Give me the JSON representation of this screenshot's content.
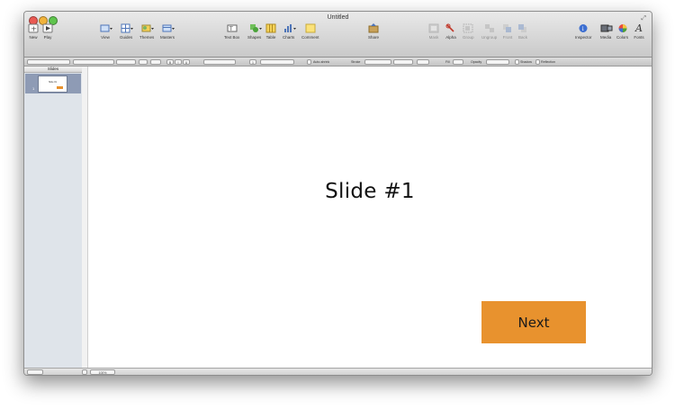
{
  "window": {
    "title": "Untitled",
    "traffic_colors": {
      "close": "#ea5a53",
      "minimize": "#f1b33b",
      "zoom": "#5fc44d"
    }
  },
  "toolbar": {
    "new": {
      "label": "New",
      "icon": "new-slide-icon"
    },
    "play": {
      "label": "Play",
      "icon": "play-icon"
    },
    "view": {
      "label": "View",
      "icon": "view-icon"
    },
    "guides": {
      "label": "Guides",
      "icon": "guides-icon"
    },
    "themes": {
      "label": "Themes",
      "icon": "themes-icon"
    },
    "masters": {
      "label": "Masters",
      "icon": "masters-icon"
    },
    "text_box": {
      "label": "Text Box",
      "icon": "text-box-icon"
    },
    "shapes": {
      "label": "Shapes",
      "icon": "shapes-icon"
    },
    "table": {
      "label": "Table",
      "icon": "table-icon"
    },
    "charts": {
      "label": "Charts",
      "icon": "charts-icon"
    },
    "comment": {
      "label": "Comment",
      "icon": "comment-icon"
    },
    "share": {
      "label": "Share",
      "icon": "share-icon"
    },
    "mask": {
      "label": "Mask",
      "icon": "mask-icon"
    },
    "alpha": {
      "label": "Alpha",
      "icon": "alpha-icon"
    },
    "group": {
      "label": "Group",
      "icon": "group-icon"
    },
    "ungroup": {
      "label": "Ungroup",
      "icon": "ungroup-icon"
    },
    "front": {
      "label": "Front",
      "icon": "front-icon"
    },
    "back": {
      "label": "Back",
      "icon": "back-icon"
    },
    "inspector": {
      "label": "Inspector",
      "icon": "inspector-icon"
    },
    "media": {
      "label": "Media",
      "icon": "media-icon"
    },
    "colors": {
      "label": "Colors",
      "icon": "colors-icon"
    },
    "fonts": {
      "label": "Fonts",
      "icon": "fonts-icon"
    }
  },
  "format_bar": {
    "auto_shrink": "Auto-shrink",
    "stroke": "Stroke",
    "fill": "Fill",
    "opacity": "Opacity",
    "shadow": "Shadow",
    "reflection": "Reflection",
    "bold": "B",
    "italic": "I",
    "underline": "U",
    "columns": "1"
  },
  "sidebar": {
    "header": "Slides",
    "slides": [
      {
        "number": "1",
        "title": "Slide #1"
      }
    ]
  },
  "slide": {
    "title": "Slide #1",
    "button_label": "Next",
    "button_color": "#e8922e"
  },
  "status": {
    "zoom": "100%"
  }
}
